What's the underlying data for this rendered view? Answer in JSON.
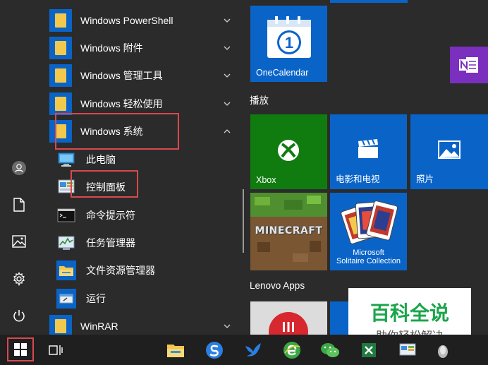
{
  "rail": {
    "items": [
      "user-icon",
      "document-icon",
      "pictures-icon",
      "settings-icon",
      "power-icon"
    ]
  },
  "applist": {
    "folders": [
      {
        "label": "Windows PowerShell"
      },
      {
        "label": "Windows 附件"
      },
      {
        "label": "Windows 管理工具"
      },
      {
        "label": "Windows 轻松使用"
      },
      {
        "label": "Windows 系统",
        "expanded": true
      }
    ],
    "system_items": [
      {
        "label": "此电脑",
        "icon": "computer-icon"
      },
      {
        "label": "控制面板",
        "icon": "control-panel-icon"
      },
      {
        "label": "命令提示符",
        "icon": "cmd-icon"
      },
      {
        "label": "任务管理器",
        "icon": "task-manager-icon"
      },
      {
        "label": "文件资源管理器",
        "icon": "file-explorer-icon"
      },
      {
        "label": "运行",
        "icon": "run-icon"
      }
    ],
    "winrar": {
      "label": "WinRAR"
    }
  },
  "tiles": {
    "onecalendar": {
      "label": "OneCalendar",
      "glyph": "1"
    },
    "play_group": "播放",
    "xbox": {
      "label": "Xbox"
    },
    "movies": {
      "label": "电影和电视"
    },
    "photos": {
      "label": "照片"
    },
    "minecraft": {
      "label": "MINECRAFT"
    },
    "solitaire": {
      "label_line1": "Microsoft",
      "label_line2": "Solitaire Collection"
    },
    "lenovo_group": "Lenovo Apps"
  },
  "watermark": {
    "title": "百科全说",
    "subtitle": "助你轻松解决"
  },
  "colors": {
    "tile_blue": "#0a64c8",
    "xbox_green": "#107c10",
    "onenote_purple": "#7b2fbe",
    "highlight_red": "#d9494e",
    "watermark_green": "#1aa54a"
  }
}
